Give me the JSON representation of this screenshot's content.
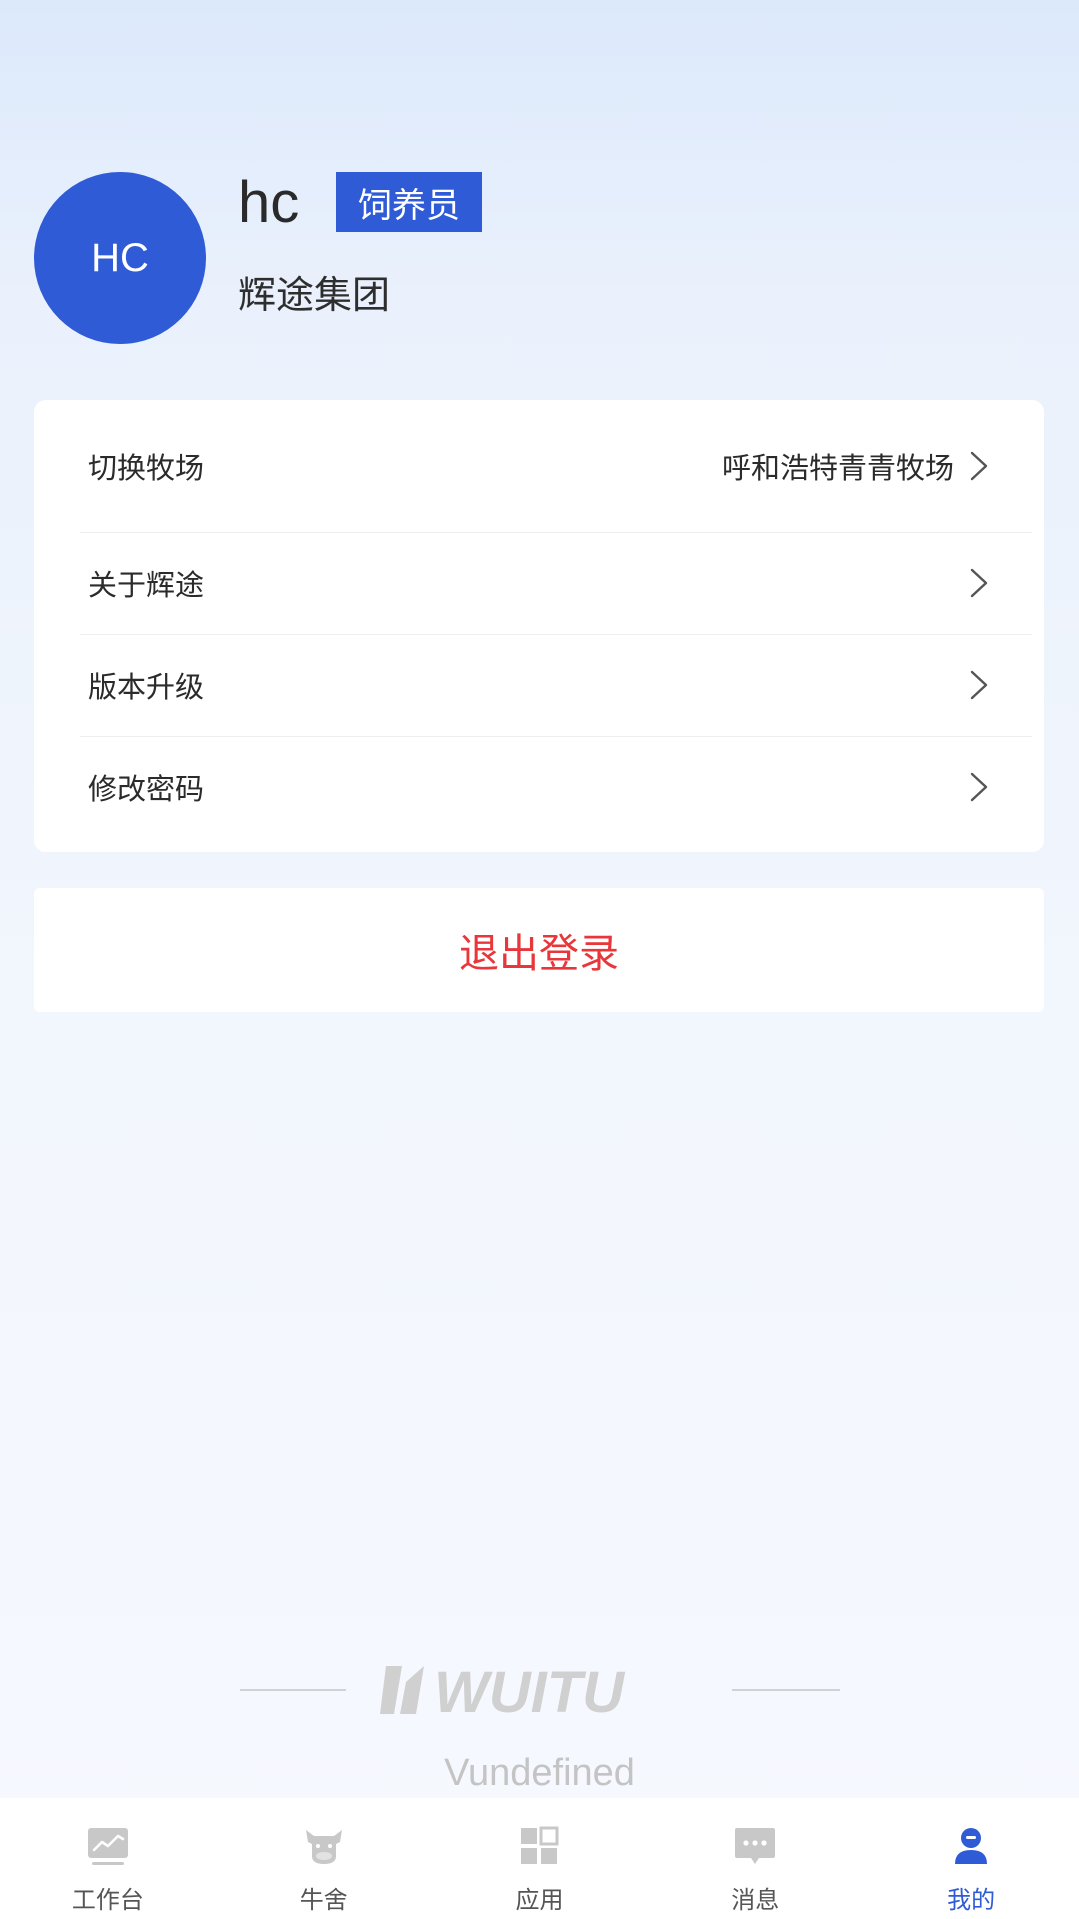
{
  "profile": {
    "avatar_initials": "HC",
    "username": "hc",
    "role": "饲养员",
    "company": "辉途集团"
  },
  "menu": {
    "switch_ranch": {
      "label": "切换牧场",
      "value": "呼和浩特青青牧场"
    },
    "about": {
      "label": "关于辉途"
    },
    "upgrade": {
      "label": "版本升级"
    },
    "password": {
      "label": "修改密码"
    }
  },
  "logout_label": "退出登录",
  "brand": {
    "logo_text": "WUITU",
    "version": "Vundefined"
  },
  "tabs": [
    {
      "label": "工作台",
      "icon": "chart-icon",
      "active": false
    },
    {
      "label": "牛舍",
      "icon": "cow-icon",
      "active": false
    },
    {
      "label": "应用",
      "icon": "grid-icon",
      "active": false
    },
    {
      "label": "消息",
      "icon": "message-icon",
      "active": false
    },
    {
      "label": "我的",
      "icon": "user-icon",
      "active": true
    }
  ],
  "colors": {
    "primary": "#2f5bd6",
    "danger": "#e8363a",
    "inactive_icon": "#c8c8c8"
  }
}
